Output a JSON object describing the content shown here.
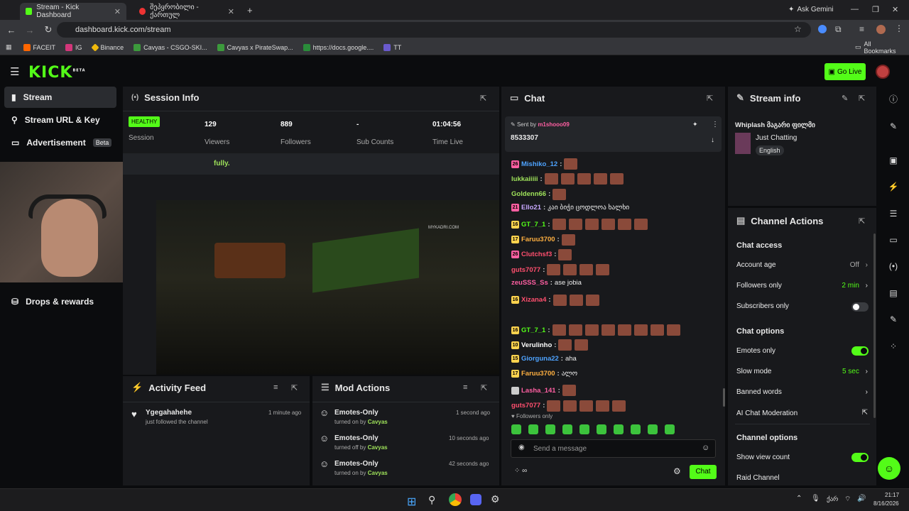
{
  "browser": {
    "tabs": [
      {
        "label": "Stream - Kick Dashboard"
      },
      {
        "label": "შეპყრობილი - ქართულ"
      }
    ],
    "ask_gemini": "Ask Gemini",
    "url": "dashboard.kick.com/stream",
    "bookmarks": [
      "FACEIT",
      "IG",
      "Binance",
      "Cavyas - CSGO-SKI...",
      "Cavyas x PirateSwap...",
      "https://docs.google....",
      "TT"
    ],
    "all_bookmarks": "All Bookmarks"
  },
  "header": {
    "logo": "KICK",
    "logo_tag": "BETA",
    "go_live": "Go Live"
  },
  "sidebar": {
    "items": [
      {
        "label": "Stream"
      },
      {
        "label": "Stream URL & Key"
      },
      {
        "label": "Advertisement",
        "badge": "Beta"
      },
      {
        "label": "Drops & rewards"
      }
    ]
  },
  "session": {
    "title": "Session Info",
    "status": "HEALTHY",
    "status_label": "Session",
    "viewers": "129",
    "viewers_label": "Viewers",
    "followers": "889",
    "followers_label": "Followers",
    "subs": "-",
    "subs_label": "Sub Counts",
    "time": "01:04:56",
    "time_label": "Time Live",
    "notice": "fully.",
    "watermark": "MYKADRI.COM"
  },
  "activity": {
    "title": "Activity Feed",
    "items": [
      {
        "name": "Ygegahahehe",
        "time": "1 minute ago",
        "desc": "just followed the channel"
      }
    ]
  },
  "mod": {
    "title": "Mod Actions",
    "items": [
      {
        "action": "Emotes-Only",
        "time": "1 second ago",
        "desc": "turned on by",
        "user": "Cavyas"
      },
      {
        "action": "Emotes-Only",
        "time": "10 seconds ago",
        "desc": "turned off by",
        "user": "Cavyas"
      },
      {
        "action": "Emotes-Only",
        "time": "42 seconds ago",
        "desc": "turned on by",
        "user": "Cavyas"
      }
    ]
  },
  "chat": {
    "title": "Chat",
    "pinned_by_label": "Sent by",
    "pinned_by": "m1shooo09",
    "pinned_text": "8533307",
    "messages": [
      {
        "user": "Mishiko_12",
        "text": "",
        "color": "#4ea3ff",
        "badge": "26",
        "badge_color": "#ff5fa2",
        "emotes": 1
      },
      {
        "user": "lukkaiiiii",
        "text": "",
        "color": "#9fe35a",
        "badge": "",
        "badge_color": "",
        "emotes": 5
      },
      {
        "user": "Goldenn66",
        "text": "",
        "color": "#9fe35a",
        "badge": "",
        "badge_color": "",
        "emotes": 1
      },
      {
        "user": "Ello21",
        "text": "კაი ბიჭი ცოდლოა ხალხი",
        "color": "#c8a8ff",
        "badge": "21",
        "badge_color": "#ff5fa2",
        "emotes": 0
      },
      {
        "user": "GT_7_1",
        "text": "",
        "color": "#53fc18",
        "badge": "16",
        "badge_color": "#ffd34e",
        "emotes": 6
      },
      {
        "user": "Faruu3700",
        "text": "",
        "color": "#ffb040",
        "badge": "17",
        "badge_color": "#ffd34e",
        "emotes": 1
      },
      {
        "user": "Clutchsf3",
        "text": "",
        "color": "#ff4f6e",
        "badge": "26",
        "badge_color": "#ff5fa2",
        "emotes": 1
      },
      {
        "user": "guts7077",
        "text": "",
        "color": "#ff4f6e",
        "badge": "",
        "badge_color": "",
        "emotes": 4
      },
      {
        "user": "zeuSSS_Ss",
        "text": "ase jobia",
        "color": "#ff5fa2",
        "badge": "",
        "badge_color": "",
        "emotes": 0
      },
      {
        "user": "Xizana4",
        "text": "",
        "color": "#ff4f6e",
        "badge": "16",
        "badge_color": "#ffd34e",
        "emotes": 3
      },
      {
        "user": "GT_7_1",
        "text": "",
        "color": "#53fc18",
        "badge": "16",
        "badge_color": "#ffd34e",
        "emotes": 10
      },
      {
        "user": "Verulinho",
        "text": "",
        "color": "#ffffff",
        "badge": "10",
        "badge_color": "#ffd34e",
        "emotes": 2
      },
      {
        "user": "Giorguna22",
        "text": "aha",
        "color": "#4ea3ff",
        "badge": "15",
        "badge_color": "#ffd34e",
        "emotes": 0
      },
      {
        "user": "Faruu3700",
        "text": "ალო",
        "color": "#ffb040",
        "badge": "17",
        "badge_color": "#ffd34e",
        "emotes": 0
      },
      {
        "user": "Lasha_141",
        "text": "",
        "color": "#ff5fa2",
        "badge": "",
        "badge_color": "#cccccc",
        "emotes": 1
      },
      {
        "user": "guts7077",
        "text": "",
        "color": "#ff4f6e",
        "badge": "",
        "badge_color": "",
        "emotes": 5
      }
    ],
    "followers_only": "Followers only",
    "placeholder": "Send a message",
    "send": "Chat"
  },
  "stream_info": {
    "title": "Stream info",
    "stream_title": "Whiplash მაგარი ფილმი",
    "category": "Just Chatting",
    "language": "English"
  },
  "channel_actions": {
    "title": "Channel Actions",
    "chat_access": "Chat access",
    "account_age": "Account age",
    "account_age_val": "Off",
    "followers_only": "Followers only",
    "followers_only_val": "2 min",
    "subscribers_only": "Subscribers only",
    "chat_options": "Chat options",
    "emotes_only": "Emotes only",
    "slow_mode": "Slow mode",
    "slow_mode_val": "5 sec",
    "banned_words": "Banned words",
    "ai_moderation": "AI Chat Moderation",
    "channel_options": "Channel options",
    "show_view_count": "Show view count",
    "raid_channel": "Raid Channel"
  },
  "taskbar": {
    "lang": "ქარ",
    "time": "21:17",
    "date": "8/16/2026"
  },
  "colors": {
    "accent": "#53fc18",
    "panel": "#18191c",
    "bg": "#0b0c0e"
  }
}
